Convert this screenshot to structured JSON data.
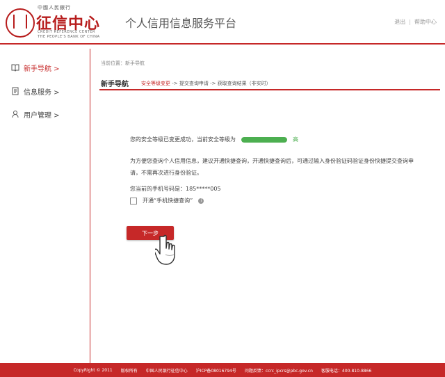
{
  "header": {
    "logo": {
      "top_text": "中國人民銀行",
      "name": "征信中心",
      "subtitle_line1": "CREDIT REFERENCE CENTER",
      "subtitle_line2": "THE PEOPLE'S BANK OF CHINA"
    },
    "platform_title": "个人信用信息服务平台",
    "links": {
      "logout": "退出",
      "help": "帮助中心",
      "separator": "|"
    }
  },
  "sidebar": {
    "items": [
      {
        "label": "新手导航 >",
        "icon": "book-icon",
        "active": true
      },
      {
        "label": "信息服务 >",
        "icon": "document-icon",
        "active": false
      },
      {
        "label": "用户管理 >",
        "icon": "user-icon",
        "active": false
      }
    ]
  },
  "main": {
    "breadcrumb": "当前位置：新手导航",
    "section_title": "新手导航",
    "steps": {
      "step1": "安全等级变更",
      "arrow1": " -> ",
      "step2": "提交查询申请",
      "arrow2": " -> ",
      "step3": "获取查询结果（非实时）"
    },
    "security_msg": "您的安全等级已变更成功，当前安全等级为",
    "security_level": "高",
    "security_level_fill": 1.0,
    "info_paragraph": "为方便您查询个人信用信息，建议开通快捷查询，开通快捷查询后，可通过输入身份验证码验证身份快捷提交查询申请，不需再次进行身份验证。",
    "phone_label": "您当前的手机号码是：185*****005",
    "checkbox_label": "开通“手机快捷查询”",
    "info_icon_glyph": "i",
    "next_button": "下一步"
  },
  "footer": {
    "copyright": "CopyRight © 2011",
    "rights": "版权所有",
    "org": "中国人民银行征信中心",
    "icp": "沪ICP备08016794号",
    "feedback": "问题反馈：ccrc_ipcrs@pbc.gov.cn",
    "hotline": "客服电话：400-810-8866"
  },
  "colors": {
    "brand_red": "#c62828",
    "level_green": "#4caf50"
  }
}
